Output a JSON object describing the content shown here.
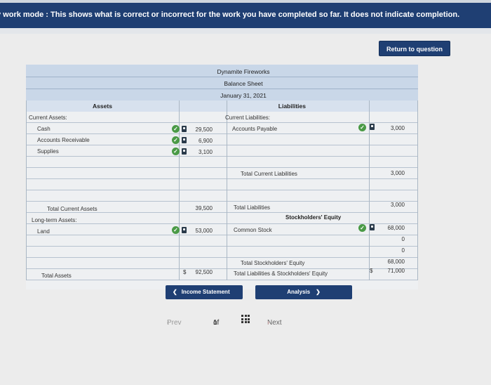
{
  "banner": {
    "text": "y work mode : This shows what is correct or incorrect for the work you have completed so far. It does not indicate completion."
  },
  "return_button": "Return to question",
  "sheet": {
    "company": "Dynamite Fireworks",
    "statement": "Balance Sheet",
    "date": "January 31, 2021",
    "assets_header": "Assets",
    "liabilities_header": "Liabilities",
    "left": {
      "current_assets": "Current Assets:",
      "cash": "Cash",
      "cash_amt": "29,500",
      "ar": "Accounts Receivable",
      "ar_amt": "6,900",
      "supplies": "Supplies",
      "supplies_amt": "3,100",
      "total_current": "Total Current Assets",
      "total_current_amt": "39,500",
      "long_term": "Long-term Assets:",
      "land": "Land",
      "land_amt": "53,000",
      "total_assets": "Total Assets",
      "dollar": "$",
      "total_assets_amt": "92,500"
    },
    "right": {
      "current_liab": "Current Liabilities:",
      "ap": "Accounts Payable",
      "ap_amt": "3,000",
      "total_current_liab": "Total Current Liabilities",
      "total_current_liab_amt": "3,000",
      "total_liab": "Total Liabilities",
      "total_liab_amt": "3,000",
      "se_header": "Stockholders' Equity",
      "common_stock": "Common Stock",
      "common_stock_amt": "68,000",
      "blank1_amt": "0",
      "blank2_amt": "0",
      "total_se": "Total Stockholders' Equity",
      "total_se_amt": "68,000",
      "total_le": "Total Liabilities & Stockholders' Equity",
      "dollar": "$",
      "total_le_amt": "71,000"
    }
  },
  "nav": {
    "prev_tab": "Income Statement",
    "next_tab": "Analysis",
    "prev": "Prev",
    "page": "1",
    "of": "of",
    "total": "1",
    "next": "Next"
  },
  "colors": {
    "accent": "#1f3f73",
    "check": "#4a9a46",
    "header_band": "#c9d7e8"
  }
}
